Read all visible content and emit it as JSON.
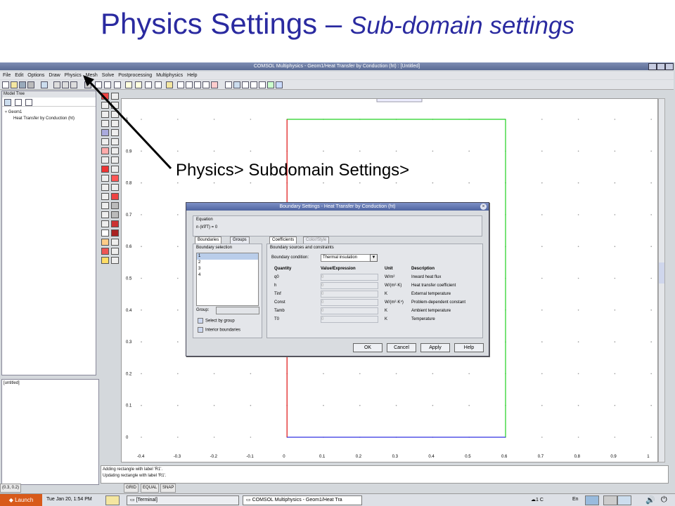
{
  "slide": {
    "title": "Physics Settings – ",
    "subtitle": "Sub-domain settings"
  },
  "window": {
    "title": "COMSOL Multiphysics - Geom1/Heat Transfer by Conduction (ht) : [Untitled]"
  },
  "menu": [
    "File",
    "Edit",
    "Options",
    "Draw",
    "Physics",
    "Mesh",
    "Solve",
    "Postprocessing",
    "Multiphysics",
    "Help"
  ],
  "model_tree": {
    "header": "Model Tree",
    "root": "Geom1",
    "child": "Heat Transfer by Conduction (ht)"
  },
  "untitled_panel": "[untitled]",
  "canvas": {
    "y_ticks": [
      "1",
      "0.9",
      "0.8",
      "0.7",
      "0.6",
      "0.5",
      "0.4",
      "0.3",
      "0.2",
      "0.1",
      "0"
    ],
    "x_ticks": [
      "-0.4",
      "-0.3",
      "-0.2",
      "-0.1",
      "0",
      "0.1",
      "0.2",
      "0.3",
      "0.4",
      "0.5",
      "0.6",
      "0.7",
      "0.8",
      "0.9",
      "1"
    ],
    "rectangle": {
      "left_edge_color": "#e01010",
      "right_edge_color": "#20d020",
      "bottom_edge_color": "#3030e0",
      "top_edge_color": "#20d020"
    }
  },
  "log": {
    "line1": "Adding rectangle with label 'R1'.",
    "line2": "Updating rectangle with label 'R1'."
  },
  "statusbar": {
    "coords": "(0.3, 0.2)",
    "grid": "GRID",
    "equal": "EQUAL",
    "snap": "SNAP"
  },
  "taskbar": {
    "launch": "Launch",
    "clock": "Tue Jan 20,  1:54 PM",
    "task1": "[Terminal]",
    "task2": "COMSOL Multiphysics - Geom1/Heat Tra",
    "temp": "1 C",
    "lang": "En"
  },
  "annotation": {
    "label": "Physics> Subdomain Settings>"
  },
  "dialog": {
    "title": "Boundary Settings - Heat Transfer by Conduction (ht)",
    "equation_header": "Equation",
    "equation": "n·(k∇T) = 0",
    "tabs_left": [
      "Boundaries",
      "Groups"
    ],
    "tabs_right": [
      "Coefficients",
      "Color/Style"
    ],
    "boundary_selection_label": "Boundary selection",
    "boundaries": [
      "1",
      "2",
      "3",
      "4"
    ],
    "group_label": "Group:",
    "select_by_group": "Select by group",
    "interior_boundaries": "Interior boundaries",
    "sources_header": "Boundary sources and constraints",
    "condition_label": "Boundary condition:",
    "condition_value": "Thermal insulation",
    "columns": [
      "Quantity",
      "Value/Expression",
      "Unit",
      "Description"
    ],
    "rows": [
      {
        "q": "q0",
        "v": "0",
        "u": "W/m²",
        "d": "Inward heat flux"
      },
      {
        "q": "h",
        "v": "0",
        "u": "W/(m²·K)",
        "d": "Heat transfer coefficient"
      },
      {
        "q": "Tinf",
        "v": "0",
        "u": "K",
        "d": "External temperature"
      },
      {
        "q": "Const",
        "v": "0",
        "u": "W/(m²·K⁴)",
        "d": "Problem-dependent constant"
      },
      {
        "q": "Tamb",
        "v": "0",
        "u": "K",
        "d": "Ambient temperature"
      },
      {
        "q": "T0",
        "v": "0",
        "u": "K",
        "d": "Temperature"
      }
    ],
    "buttons": {
      "ok": "OK",
      "cancel": "Cancel",
      "apply": "Apply",
      "help": "Help"
    }
  }
}
